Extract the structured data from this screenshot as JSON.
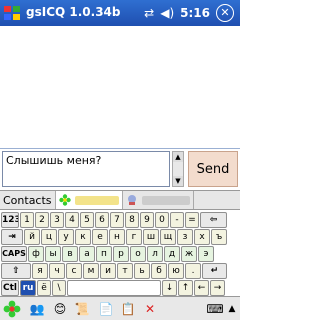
{
  "titlebar": {
    "app_title": "gsICQ 1.0.34b",
    "clock": "5:16",
    "close_label": "✕"
  },
  "message": {
    "input_value": "Слышишь меня?",
    "send_label": "Send"
  },
  "tabs": [
    {
      "label": "Contacts"
    }
  ],
  "keyboard": {
    "row1": [
      "123",
      "1",
      "2",
      "3",
      "4",
      "5",
      "6",
      "7",
      "8",
      "9",
      "0",
      "-",
      "=",
      "⇦"
    ],
    "row2": [
      "⇥",
      "й",
      "ц",
      "у",
      "к",
      "е",
      "н",
      "г",
      "ш",
      "щ",
      "з",
      "х",
      "ъ"
    ],
    "row3": [
      "CAPS",
      "ф",
      "ы",
      "в",
      "а",
      "п",
      "р",
      "о",
      "л",
      "д",
      "ж",
      "э"
    ],
    "row4": [
      "⇧",
      "я",
      "ч",
      "с",
      "м",
      "и",
      "т",
      "ь",
      "б",
      "ю",
      ".",
      "↵"
    ],
    "row5": [
      "Ctl",
      "ru",
      "ё",
      "\\",
      "",
      "↓",
      "↑",
      "←",
      "→"
    ]
  },
  "colors": {
    "titlebar": "#2f6fd1",
    "send_button": "#f3dccd",
    "key_face": "#f3f3e0",
    "lang_key": "#1f4fb0"
  }
}
